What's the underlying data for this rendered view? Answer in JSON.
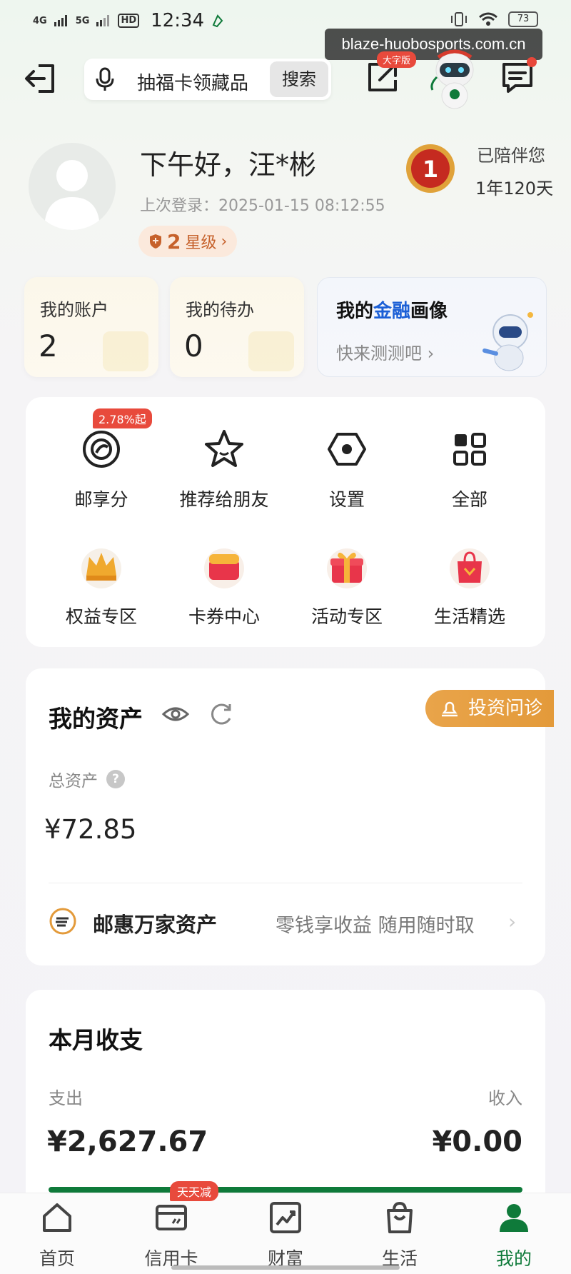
{
  "status_bar": {
    "net1": "4G",
    "net2": "5G",
    "hd": "HD",
    "time": "12:34",
    "battery": "73"
  },
  "watermark": "blaze-huobosports.com.cn",
  "header": {
    "search_placeholder": "抽福卡领藏品",
    "search_button": "搜索",
    "bigfont_badge": "大字版"
  },
  "profile": {
    "greeting": "下午好，汪*彬",
    "last_login": "上次登录：2025-01-15 08:12:55",
    "star_level_num": "2",
    "star_level_text": "星级",
    "medal_number": "1",
    "accompany_label": "已陪伴您",
    "accompany_value": "1年120天"
  },
  "summary": {
    "accounts_label": "我的账户",
    "accounts_value": "2",
    "todo_label": "我的待办",
    "todo_value": "0",
    "finance_title_pre": "我的",
    "finance_title_blue": "金融",
    "finance_title_post": "画像",
    "finance_sub": "快来测测吧"
  },
  "services": {
    "rate_badge": "2.78%起",
    "items": [
      {
        "label": "邮享分",
        "icon": "coin-icon"
      },
      {
        "label": "推荐给朋友",
        "icon": "star-icon"
      },
      {
        "label": "设置",
        "icon": "settings-hex-icon"
      },
      {
        "label": "全部",
        "icon": "grid-icon"
      },
      {
        "label": "权益专区",
        "icon": "crown-icon"
      },
      {
        "label": "卡券中心",
        "icon": "coupon-icon"
      },
      {
        "label": "活动专区",
        "icon": "gift-icon"
      },
      {
        "label": "生活精选",
        "icon": "shopping-bag-icon"
      }
    ]
  },
  "assets": {
    "title": "我的资产",
    "invest_button": "投资问诊",
    "total_label": "总资产",
    "total_value": "¥72.85",
    "brand_name": "邮惠万家资产",
    "brand_tagline": "零钱享收益 随用随时取"
  },
  "monthly": {
    "title": "本月收支",
    "expense_label": "支出",
    "income_label": "收入",
    "expense_value": "¥2,627.67",
    "income_value": "¥0.00",
    "expense_share": 1.0
  },
  "bottom_nav": {
    "badge": "天天减",
    "items": [
      {
        "label": "首页",
        "icon": "home-icon"
      },
      {
        "label": "信用卡",
        "icon": "credit-card-icon"
      },
      {
        "label": "财富",
        "icon": "chart-icon"
      },
      {
        "label": "生活",
        "icon": "bag-icon"
      },
      {
        "label": "我的",
        "icon": "user-icon"
      }
    ],
    "active_index": 4
  },
  "colors": {
    "brand_green": "#0f7a3a",
    "badge_red": "#e84a3c",
    "invest_orange": "#e39a3a",
    "finance_blue": "#1b5fd6"
  }
}
